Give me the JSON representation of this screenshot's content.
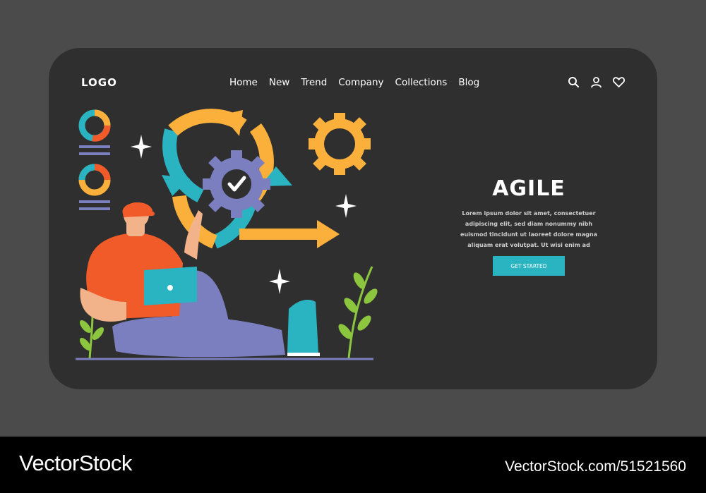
{
  "header": {
    "logo": "LOGO",
    "nav": [
      "Home",
      "New",
      "Trend",
      "Company",
      "Collections",
      "Blog"
    ],
    "icons": [
      "search-icon",
      "user-icon",
      "heart-icon"
    ]
  },
  "hero": {
    "title": "AGILE",
    "description": "Lorem ipsum dolor sit amet, consectetuer adipiscing elit, sed diam nonummy nibh euismod tincidunt ut laoreet dolore magna aliquam erat volutpat. Ut wisi enim ad",
    "cta": "GET STARTED"
  },
  "footer": {
    "brand": "VectorStock",
    "image_id": "VectorStock.com/51521560"
  },
  "colors": {
    "background": "#4b4b4b",
    "card": "#2f2f2f",
    "accent": "#2ab3c0",
    "orange": "#f15a29",
    "yellow": "#fbb03b",
    "purple": "#7b7fbf"
  }
}
